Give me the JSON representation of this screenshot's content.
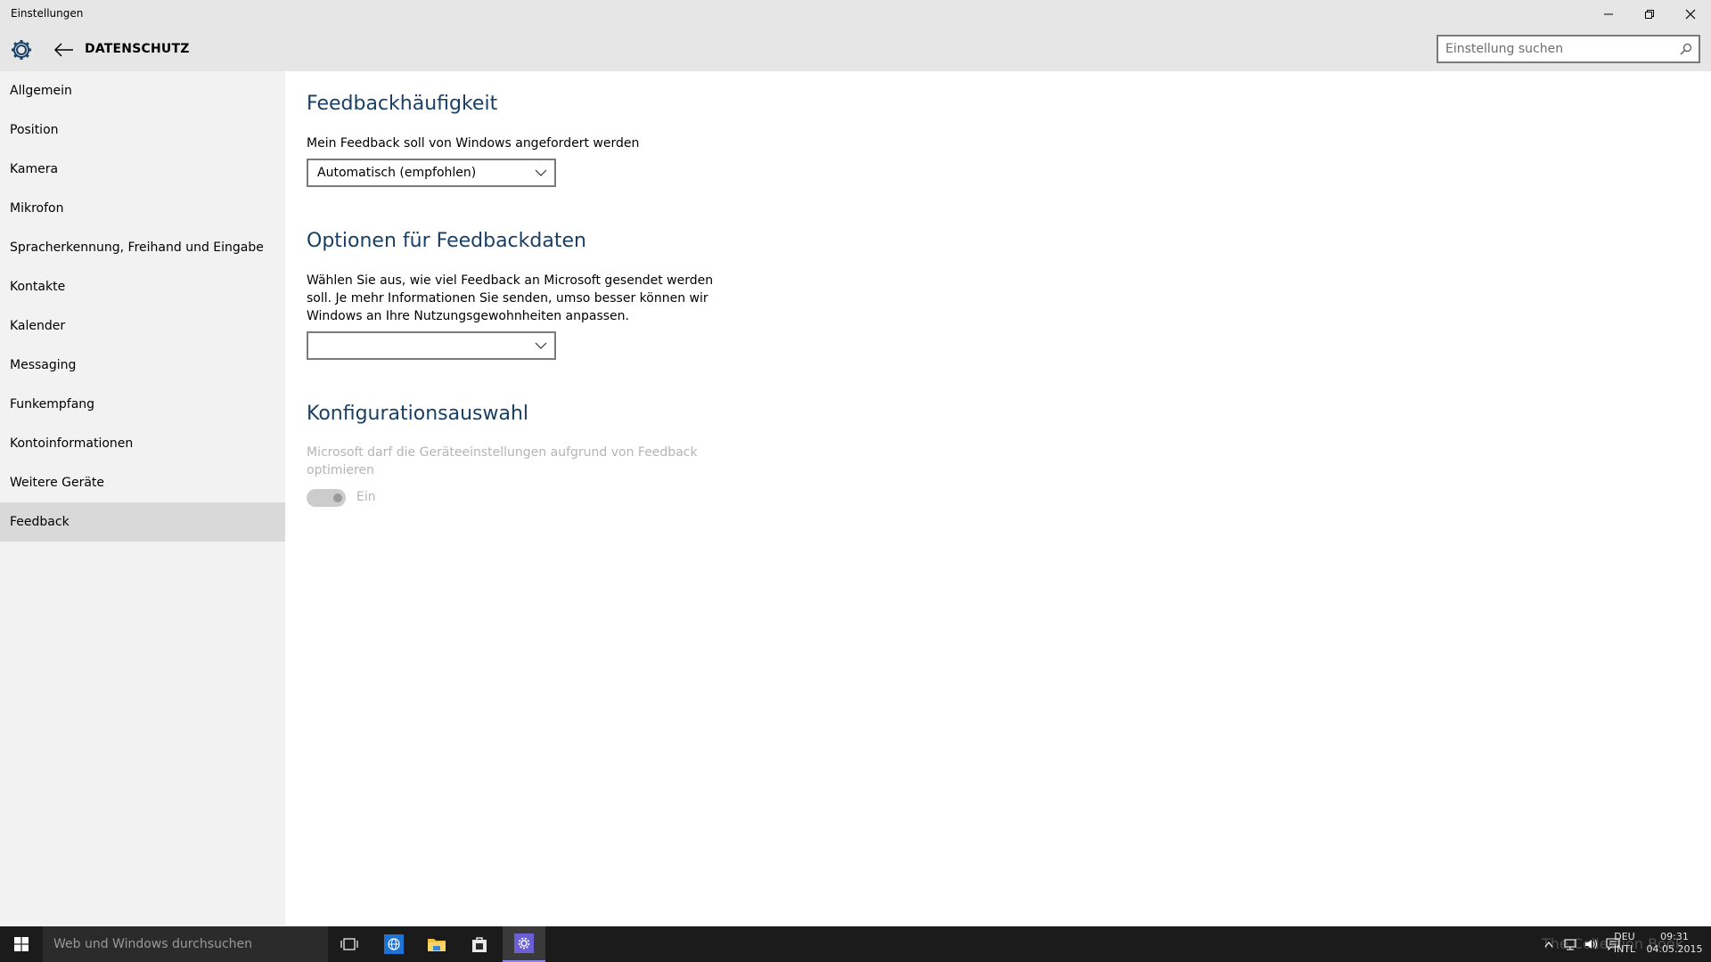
{
  "window": {
    "title": "Einstellungen"
  },
  "header": {
    "section_title": "DATENSCHUTZ",
    "search_placeholder": "Einstellung suchen"
  },
  "sidebar": {
    "items": [
      {
        "label": "Allgemein"
      },
      {
        "label": "Position"
      },
      {
        "label": "Kamera"
      },
      {
        "label": "Mikrofon"
      },
      {
        "label": "Spracherkennung, Freihand und Eingabe"
      },
      {
        "label": "Kontakte"
      },
      {
        "label": "Kalender"
      },
      {
        "label": "Messaging"
      },
      {
        "label": "Funkempfang"
      },
      {
        "label": "Kontoinformationen"
      },
      {
        "label": "Weitere Geräte"
      },
      {
        "label": "Feedback"
      }
    ],
    "selected_index": 11
  },
  "main": {
    "feedback_frequency": {
      "heading": "Feedbackhäufigkeit",
      "label": "Mein Feedback soll von Windows angefordert werden",
      "value": "Automatisch (empfohlen)"
    },
    "feedback_data": {
      "heading": "Optionen für Feedbackdaten",
      "description_line1": "Wählen Sie aus, wie viel Feedback an Microsoft gesendet werden",
      "description_line2": "soll. Je mehr Informationen Sie senden, umso besser können wir",
      "description_line3": "Windows an Ihre Nutzungsgewohnheiten anpassen.",
      "value": ""
    },
    "configuration": {
      "heading": "Konfigurationsauswahl",
      "description_line1": "Microsoft darf die Geräteeinstellungen aufgrund von Feedback",
      "description_line2": "optimieren",
      "toggle_label": "Ein"
    }
  },
  "taskbar": {
    "search_placeholder": "Web und Windows durchsuchen",
    "language_line1": "DEU",
    "language_line2": "INTL",
    "time": "09:31",
    "date": "04.05.2015",
    "watermark": "The Collection Book"
  },
  "colors": {
    "heading": "#1a3f66",
    "sidebar_bg": "#f2f2f2",
    "selected_bg": "#d9d9d9",
    "titlebar_bg": "#e6e6e6",
    "taskbar_bg": "#1b1b1b",
    "accent": "#6b5fd6"
  }
}
